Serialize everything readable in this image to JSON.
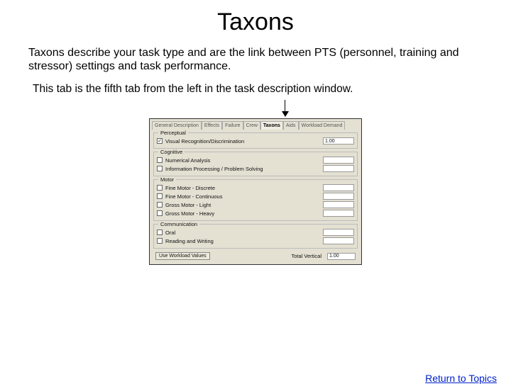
{
  "title": "Taxons",
  "intro": "Taxons describe your task type and are the link between PTS (personnel, training and stressor) settings and task performance.",
  "subintro": "This tab is the fifth tab from the left in the task description window.",
  "tabs": [
    "General Description",
    "Effects",
    "Failure",
    "Crew",
    "Taxons",
    "Aids",
    "Workload Demand"
  ],
  "groups": {
    "perceptual": {
      "title": "Perceptual",
      "items": [
        {
          "label": "Visual Recognition/Discrimination",
          "checked": true,
          "value": "1.00"
        }
      ]
    },
    "cognitive": {
      "title": "Cognitive",
      "items": [
        {
          "label": "Numerical Analysis",
          "checked": false,
          "value": ""
        },
        {
          "label": "Information Processing / Problem Solving",
          "checked": false,
          "value": ""
        }
      ]
    },
    "motor": {
      "title": "Motor",
      "items": [
        {
          "label": "Fine Motor - Discrete",
          "checked": false,
          "value": ""
        },
        {
          "label": "Fine Motor - Continuous",
          "checked": false,
          "value": ""
        },
        {
          "label": "Gross Motor - Light",
          "checked": false,
          "value": ""
        },
        {
          "label": "Gross Motor - Heavy",
          "checked": false,
          "value": ""
        }
      ]
    },
    "communication": {
      "title": "Communication",
      "items": [
        {
          "label": "Oral",
          "checked": false,
          "value": ""
        },
        {
          "label": "Reading and Writing",
          "checked": false,
          "value": ""
        }
      ]
    }
  },
  "button": "Use Workload Values",
  "total_label": "Total Vertical",
  "total_value": "1.00",
  "return_link": "Return to Topics"
}
